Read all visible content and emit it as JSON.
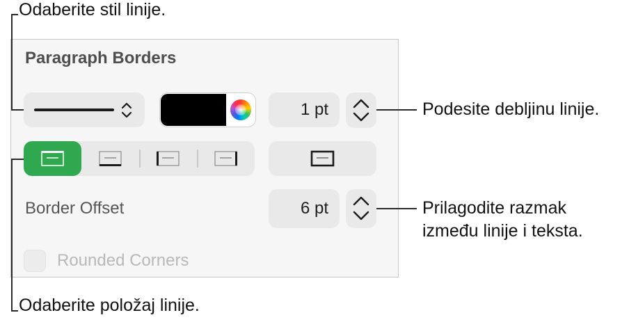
{
  "callouts": {
    "line_style": "Odaberite stil linije.",
    "line_width": "Podesite debljinu linije.",
    "offset_line1": "Prilagodite razmak",
    "offset_line2": "između linije i teksta.",
    "position": "Odaberite položaj linije."
  },
  "panel": {
    "title": "Paragraph Borders",
    "line_style_selected": "solid",
    "color_swatch": "#000000",
    "width_value": "1 pt",
    "border_positions": [
      "top",
      "bottom",
      "left",
      "right",
      "box"
    ],
    "selected_position": "top",
    "accent_color": "#2fa84f",
    "border_offset_label": "Border Offset",
    "border_offset_value": "6 pt",
    "rounded_corners_label": "Rounded Corners",
    "rounded_corners_enabled": false
  }
}
